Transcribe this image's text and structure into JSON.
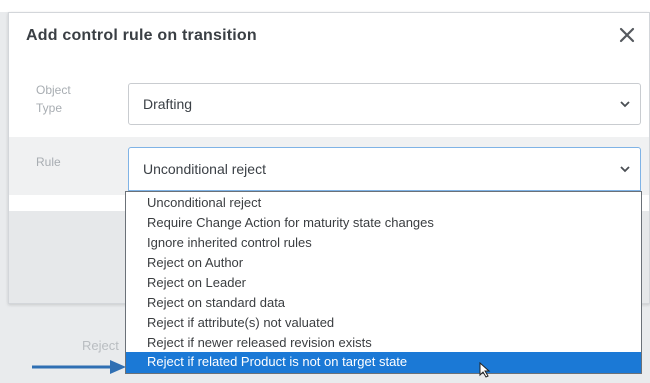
{
  "dialog": {
    "title": "Add control rule on transition",
    "close_icon": "close-icon"
  },
  "form": {
    "object_type": {
      "label_line1": "Object",
      "label_line2": "Type",
      "value": "Drafting"
    },
    "rule": {
      "label": "Rule",
      "value": "Unconditional reject"
    }
  },
  "dropdown": {
    "options": [
      "Unconditional reject",
      "Require Change Action for maturity state changes",
      "Ignore inherited control rules",
      "Reject on Author",
      "Reject on Leader",
      "Reject on standard data",
      "Reject if attribute(s) not valuated",
      "Reject if newer released revision exists",
      "Reject if related Product is not on target state"
    ],
    "selected_index": 8
  },
  "background": {
    "ghost_label": "Reject"
  },
  "colors": {
    "highlight": "#1b79d6",
    "arrow": "#2f6fb3"
  }
}
